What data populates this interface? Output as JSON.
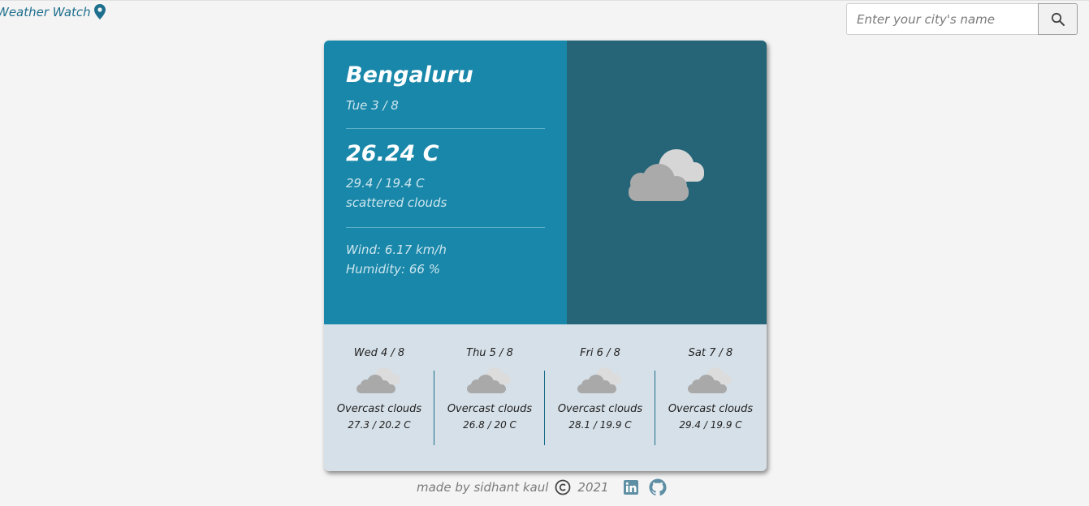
{
  "header": {
    "brand": "Weather Watch",
    "brand_icon": "map-pin-icon",
    "search_placeholder": "Enter your city's name",
    "search_icon": "search-icon"
  },
  "current": {
    "city": "Bengaluru",
    "date": "Tue 3 / 8",
    "temp": "26.24 C",
    "minmax": "29.4 / 19.4 C",
    "description": "scattered clouds",
    "wind": "Wind: 6.17 km/h",
    "humidity": "Humidity: 66 %",
    "icon": "scattered-clouds-icon"
  },
  "forecast": [
    {
      "date": "Wed 4 / 8",
      "description": "Overcast clouds",
      "temps": "27.3 / 20.2 C",
      "icon": "overcast-clouds-icon"
    },
    {
      "date": "Thu 5 / 8",
      "description": "Overcast clouds",
      "temps": "26.8 / 20 C",
      "icon": "overcast-clouds-icon"
    },
    {
      "date": "Fri 6 / 8",
      "description": "Overcast clouds",
      "temps": "28.1 / 19.9 C",
      "icon": "overcast-clouds-icon"
    },
    {
      "date": "Sat 7 / 8",
      "description": "Overcast clouds",
      "temps": "29.4 / 19.9 C",
      "icon": "overcast-clouds-icon"
    }
  ],
  "footer": {
    "credit": "made by sidhant kaul",
    "year": "2021",
    "copyright_icon": "copyright-icon",
    "linkedin_icon": "linkedin-icon",
    "github_icon": "github-icon"
  },
  "colors": {
    "brand": "#1e6f8e",
    "current_panel": "#1987a9",
    "icon_panel": "#256577",
    "forecast_panel": "#d6e0e8",
    "page_bg": "#f4f4f4"
  }
}
